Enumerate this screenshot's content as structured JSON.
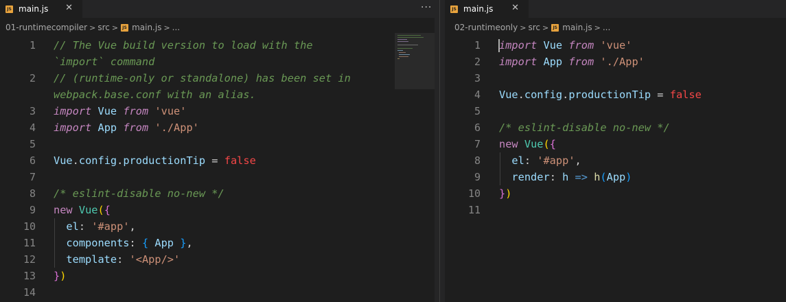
{
  "left": {
    "tab": {
      "icon_text": "JS",
      "label": "main.js",
      "close": "✕"
    },
    "more": "···",
    "breadcrumb": {
      "folder": "01-runtimecompiler",
      "sub": "src",
      "file": "main.js",
      "tail": "..."
    },
    "line_numbers": [
      "1",
      "2",
      "3",
      "4",
      "5",
      "6",
      "7",
      "8",
      "9",
      "10",
      "11",
      "12",
      "13",
      "14"
    ],
    "code": {
      "l1a": "// The Vue build version to load with the",
      "l1b": "`import` command",
      "l2a": "// (runtime-only or standalone) has been set in",
      "l2b": "webpack.base.conf with an alias.",
      "l3": [
        "import",
        "Vue",
        "from",
        "'vue'"
      ],
      "l4": [
        "import",
        "App",
        "from",
        "'./App'"
      ],
      "l6": [
        "Vue",
        "config",
        "productionTip",
        "=",
        "false"
      ],
      "l8": "/* eslint-disable no-new */",
      "l9": [
        "new",
        "Vue",
        "(",
        "{"
      ],
      "l10": [
        "el",
        "'#app'"
      ],
      "l11": [
        "components",
        "{",
        "App",
        "}"
      ],
      "l12": [
        "template",
        "'<App/>'"
      ],
      "l13": [
        "}",
        ")"
      ]
    }
  },
  "right": {
    "tab": {
      "icon_text": "JS",
      "label": "main.js",
      "close": "✕"
    },
    "breadcrumb": {
      "folder": "02-runtimeonly",
      "sub": "src",
      "file": "main.js",
      "tail": "..."
    },
    "line_numbers": [
      "1",
      "2",
      "3",
      "4",
      "5",
      "6",
      "7",
      "8",
      "9",
      "10",
      "11"
    ],
    "code": {
      "l1": [
        "import",
        "Vue",
        "from",
        "'vue'"
      ],
      "l2": [
        "import",
        "App",
        "from",
        "'./App'"
      ],
      "l4": [
        "Vue",
        "config",
        "productionTip",
        "=",
        "false"
      ],
      "l6": "/* eslint-disable no-new */",
      "l7": [
        "new",
        "Vue",
        "(",
        "{"
      ],
      "l8": [
        "el",
        "'#app'"
      ],
      "l9": [
        "render",
        "h",
        "=>",
        "h",
        "App"
      ],
      "l10": [
        "}",
        ")"
      ]
    }
  },
  "colors": {
    "background": "#1e1e1e",
    "comment": "#6a9955",
    "keyword": "#c586c0",
    "string": "#ce9178",
    "boolean": "#f44747",
    "line_number": "#858585",
    "js_icon": "#e8a33d"
  }
}
